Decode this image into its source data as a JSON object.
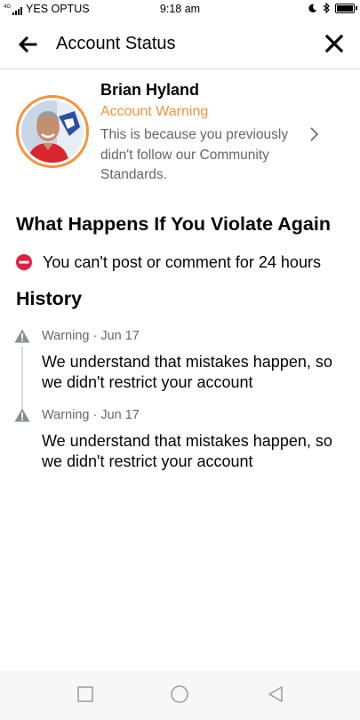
{
  "status_bar": {
    "network": "4G",
    "carrier": "YES OPTUS",
    "time": "9:18 am",
    "battery_level": 1.0
  },
  "header": {
    "title": "Account Status",
    "back_icon": "arrow-left-icon",
    "close_icon": "close-icon"
  },
  "profile": {
    "name": "Brian Hyland",
    "status_label": "Account Warning",
    "reason": "This is because you previously didn't follow our Community Standards.",
    "ring_color": "#f7923a"
  },
  "consequences": {
    "title": "What Happens If You Violate Again",
    "items": [
      {
        "icon": "no-entry-icon",
        "text": "You can't post or comment for 24 hours"
      }
    ]
  },
  "history": {
    "title": "History",
    "entries": [
      {
        "icon": "warning-triangle-icon",
        "meta": "Warning · Jun 17",
        "text": "We understand that mistakes happen, so we didn't restrict your account"
      },
      {
        "icon": "warning-triangle-icon",
        "meta": "Warning · Jun 17",
        "text": "We understand that mistakes happen, so we didn't restrict your account"
      }
    ]
  },
  "nav_bar": {
    "buttons": [
      "recents-square-icon",
      "home-circle-icon",
      "back-triangle-icon"
    ]
  },
  "colors": {
    "accent": "#f7923a",
    "danger": "#e41e3f",
    "secondary_text": "#65676b"
  }
}
